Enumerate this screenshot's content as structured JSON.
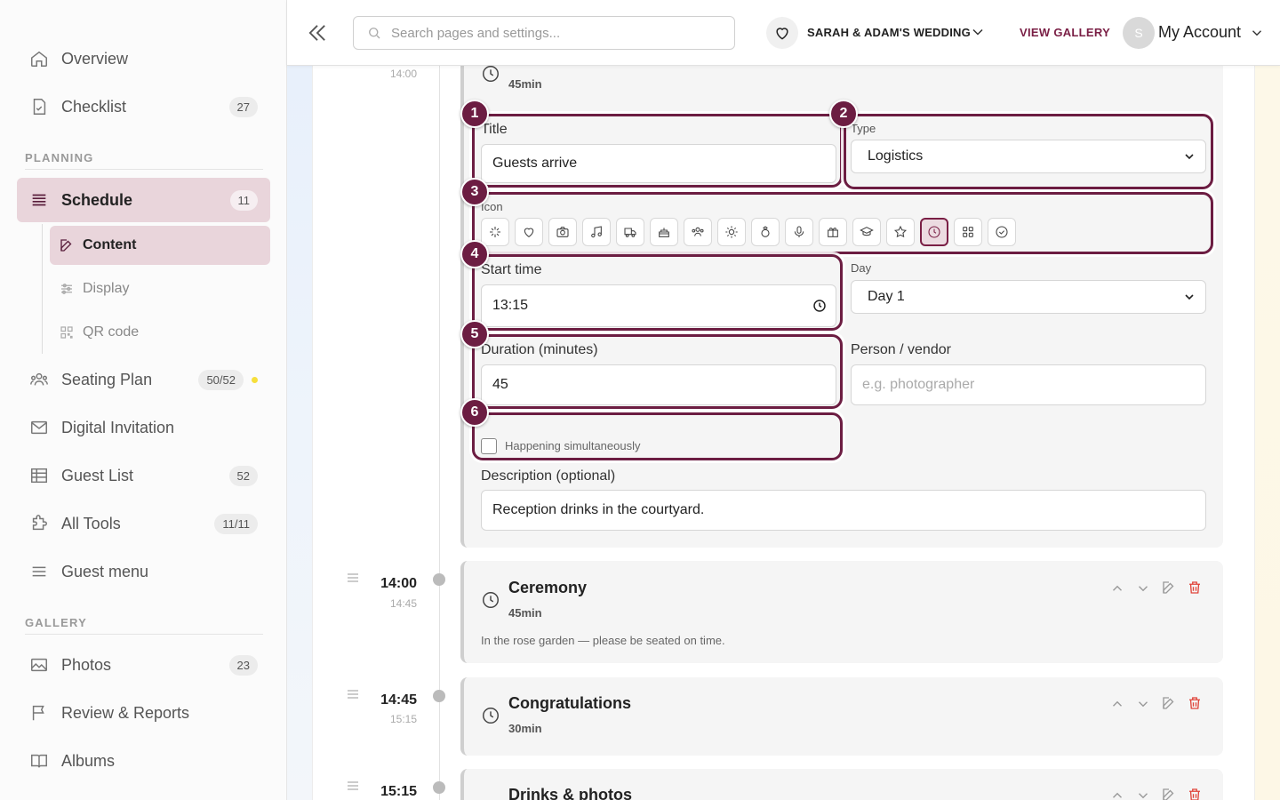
{
  "sidebar": {
    "items": [
      {
        "label": "Overview",
        "icon": "home-icon"
      },
      {
        "label": "Checklist",
        "icon": "document-check-icon",
        "badge": "27"
      },
      {
        "label": "Schedule",
        "icon": "list-icon",
        "badge": "11"
      },
      {
        "label": "Seating Plan",
        "icon": "people-group-icon",
        "badge": "50/52"
      },
      {
        "label": "Digital Invitation",
        "icon": "envelope-icon"
      },
      {
        "label": "Guest List",
        "icon": "table-icon",
        "badge": "52"
      },
      {
        "label": "All Tools",
        "icon": "puzzle-icon",
        "badge": "11/11"
      },
      {
        "label": "Guest menu",
        "icon": "menu-lines-icon"
      },
      {
        "label": "Photos",
        "icon": "image-icon",
        "badge": "23"
      },
      {
        "label": "Review & Reports",
        "icon": "flag-icon"
      },
      {
        "label": "Albums",
        "icon": "book-open-icon"
      }
    ],
    "sections": {
      "planning": "PLANNING",
      "gallery": "GALLERY"
    },
    "subitems": [
      {
        "label": "Content",
        "icon": "edit-icon"
      },
      {
        "label": "Display",
        "icon": "sliders-icon"
      },
      {
        "label": "QR code",
        "icon": "qr-icon"
      }
    ]
  },
  "topbar": {
    "search_placeholder": "Search pages and settings...",
    "wedding": "SARAH & ADAM'S WEDDING",
    "view_gallery": "VIEW GALLERY",
    "avatar_initial": "S",
    "account": "My Account"
  },
  "editor": {
    "top_time": "14:00",
    "top_duration": "45min",
    "title_label": "Title",
    "title_value": "Guests arrive",
    "type_label": "Type",
    "type_value": "Logistics",
    "icon_label": "Icon",
    "icons": [
      "sparkles-icon",
      "heart-icon",
      "camera-icon",
      "music-icon",
      "truck-icon",
      "cake-icon",
      "people-icon",
      "sun-icon",
      "ring-icon",
      "microphone-icon",
      "gift-icon",
      "graduation-cap-icon",
      "star-icon",
      "clock-icon",
      "grid-icon",
      "check-circle-icon"
    ],
    "selected_icon": "clock-icon",
    "start_label": "Start time",
    "start_value": "13:15",
    "day_label": "Day",
    "day_value": "Day 1",
    "duration_label": "Duration (minutes)",
    "duration_value": "45",
    "person_label": "Person / vendor",
    "person_placeholder": "e.g. photographer",
    "simultaneous_label": "Happening simultaneously",
    "description_label": "Description (optional)",
    "description_value": "Reception drinks in the courtyard.",
    "callouts": [
      "1",
      "2",
      "3",
      "4",
      "5",
      "6"
    ]
  },
  "events": [
    {
      "start": "14:00",
      "end": "14:45",
      "title": "Ceremony",
      "duration": "45min",
      "description": "In the rose garden — please be seated on time."
    },
    {
      "start": "14:45",
      "end": "15:15",
      "title": "Congratulations",
      "duration": "30min"
    },
    {
      "start": "15:15",
      "title": "Drinks & photos"
    }
  ],
  "colors": {
    "accent": "#6c1d42",
    "active_bg": "#e9d5db",
    "delete": "#e0443a"
  }
}
